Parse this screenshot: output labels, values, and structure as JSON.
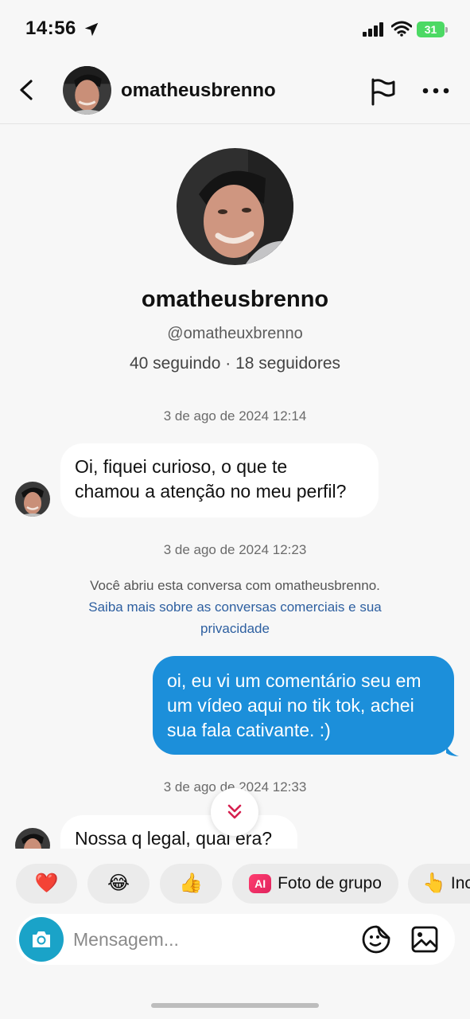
{
  "status_bar": {
    "time": "14:56",
    "battery": "31",
    "battery_color": "#4cd964",
    "icons": [
      "location-arrow-icon",
      "signal-icon",
      "wifi-icon",
      "battery-icon"
    ]
  },
  "header": {
    "username": "omatheusbrenno",
    "icons": [
      "back-chevron-icon",
      "flag-icon",
      "more-dots-icon"
    ]
  },
  "profile": {
    "name": "omatheusbrenno",
    "handle": "@omatheuxbrenno",
    "stats": "40 seguindo · 18 seguidores"
  },
  "messages": {
    "ts1": "3 de ago de 2024 12:14",
    "msg1_line1": "Oi, fiquei curioso, o que te",
    "msg1_line2": "chamou a atenção no meu perfil?",
    "ts2": "3 de ago de 2024 12:23",
    "system_text": "Você abriu esta conversa com omatheusbrenno.",
    "system_link_line1": "Saiba mais sobre as conversas comerciais e sua",
    "system_link_line2": "privacidade",
    "msg2_line1": "oi, eu vi um comentário seu em",
    "msg2_line2": "um vídeo aqui no tik tok, achei",
    "msg2_line3": "sua fala cativante. :)",
    "ts3": "3 de ago de 2024 12:33",
    "msg3": "Nossa q legal, qual era?"
  },
  "quick_replies": {
    "heart": "❤️",
    "laugh": "😂",
    "thumbs": "👍",
    "ai_badge": "AI",
    "group_photo": "Foto de grupo",
    "point": "👆",
    "point_label": "Inc"
  },
  "composer": {
    "placeholder": "Mensagem...",
    "icons": [
      "camera-icon",
      "sticker-icon",
      "gallery-icon"
    ]
  },
  "colors": {
    "accent_blue": "#1c8fda",
    "camera_teal": "#1aa3c8",
    "link_blue": "#2d5fa0"
  }
}
